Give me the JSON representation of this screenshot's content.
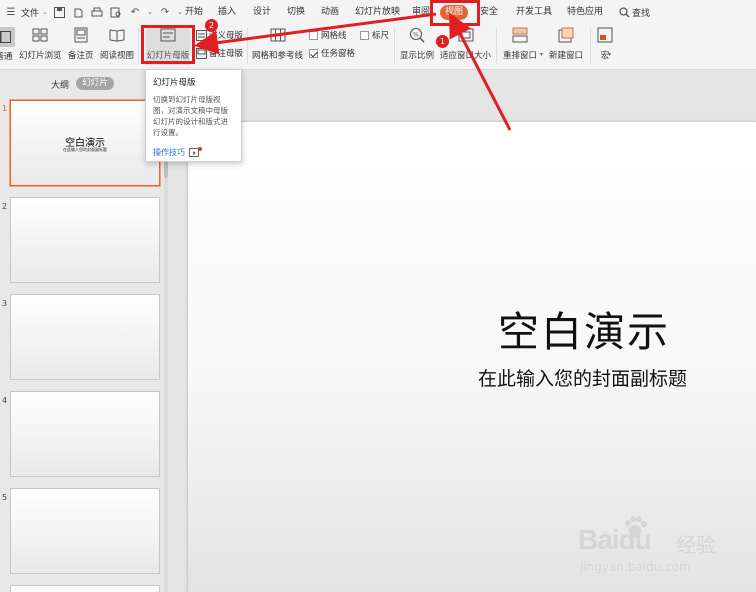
{
  "menubar": {
    "file_label": "文件",
    "find_label": "查找",
    "tabs": [
      "开始",
      "插入",
      "设计",
      "切换",
      "动画",
      "幻灯片放映",
      "审阅",
      "视图",
      "安全",
      "开发工具",
      "特色应用"
    ]
  },
  "ribbon": {
    "normal": "普通",
    "slide_sorter": "幻灯片浏览",
    "notes_page": "备注页",
    "reading_view": "阅读视图",
    "slide_master": "幻灯片母版",
    "handout_master": "讲义母版",
    "notes_master": "备注母版",
    "grid_guides": "网格和参考线",
    "gridlines": "网格线",
    "ruler": "标尺",
    "task_pane": "任务窗格",
    "zoom": "显示比例",
    "fit_window": "适应窗口大小",
    "arrange": "重排窗口",
    "new_window": "新建窗口",
    "macro": "宏"
  },
  "tooltip": {
    "title": "幻灯片母版",
    "body": "切换到幻灯片母版视图，对演示文稿中母版幻灯片的设计和版式进行设置。",
    "link": "操作技巧"
  },
  "left_panel": {
    "outline_tab": "大纲",
    "slides_tab": "幻灯片",
    "thumbnails": [
      {
        "num": "1",
        "title": "空白演示",
        "sub": "在此输入您的封面副标题"
      },
      {
        "num": "2"
      },
      {
        "num": "3"
      },
      {
        "num": "4"
      },
      {
        "num": "5"
      }
    ]
  },
  "slide": {
    "title": "空白演示",
    "subtitle": "在此输入您的封面副标题"
  },
  "annotations": {
    "badge1": "1",
    "badge2": "2"
  },
  "watermark": {
    "brand": "Baidu",
    "cn": "经验",
    "url": "jingyan.baidu.com"
  },
  "colors": {
    "accent": "#e0653a",
    "annotation": "#e02020"
  }
}
